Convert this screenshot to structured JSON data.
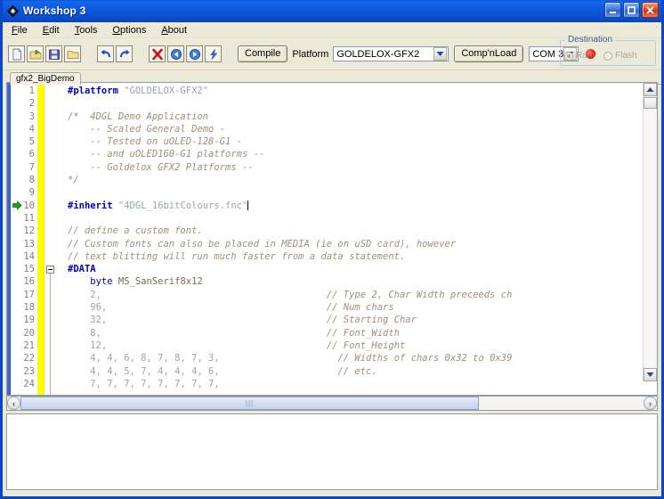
{
  "window": {
    "title": "Workshop 3",
    "icon": "app-diamond-icon",
    "titlebar_color": "#0a54d6",
    "face_color": "#ece9d8",
    "buttons": {
      "minimize": "_",
      "maximize": "□",
      "close": "✕"
    }
  },
  "menu": {
    "items": [
      {
        "label": "File",
        "accel": "F"
      },
      {
        "label": "Edit",
        "accel": "E"
      },
      {
        "label": "Tools",
        "accel": "T"
      },
      {
        "label": "Options",
        "accel": "O"
      },
      {
        "label": "About",
        "accel": "A"
      }
    ]
  },
  "toolbar": {
    "icons": [
      {
        "name": "new-file-icon",
        "tip": "New"
      },
      {
        "name": "open-folder-icon",
        "tip": "Open"
      },
      {
        "name": "save-disk-icon",
        "tip": "Save"
      },
      {
        "name": "folder-icon",
        "tip": "Save As"
      },
      {
        "name": "undo-icon",
        "tip": "Undo"
      },
      {
        "name": "redo-icon",
        "tip": "Redo"
      },
      {
        "name": "close-x-icon",
        "tip": "Close"
      },
      {
        "name": "back-arrow-icon",
        "tip": "Back"
      },
      {
        "name": "forward-arrow-icon",
        "tip": "Forward"
      },
      {
        "name": "lightning-icon",
        "tip": "Run"
      }
    ],
    "compile_label": "Compile",
    "platform_label": "Platform",
    "platform_value": "GOLDELOX-GFX2",
    "compnload_label": "Comp'nLoad",
    "com_value": "COM 3",
    "led": {
      "name": "status-led",
      "color": "#e00b0b"
    },
    "destination": {
      "legend": "Destination",
      "options": [
        {
          "label": "Ram",
          "selected": true
        },
        {
          "label": "Flash",
          "selected": false
        }
      ]
    }
  },
  "tabs": {
    "active": "gfx2_BigDemo",
    "items": [
      "gfx2_BigDemo"
    ]
  },
  "editor": {
    "colors": {
      "preprocessor": "#0000c0",
      "string": "#9aa89a",
      "comment": "#a08f7a",
      "keyword": "#0000c0",
      "identifier": "#7a6a55",
      "gutter_marker": "#ffff00",
      "line_number": "#808080"
    },
    "caret_line": 10,
    "marker_line": 10,
    "fold_line": 15,
    "lines": [
      {
        "n": "1",
        "tokens": [
          {
            "t": "#platform ",
            "c": "pre"
          },
          {
            "t": "\"GOLDELOX-GFX2\"",
            "c": "str"
          }
        ]
      },
      {
        "n": "2",
        "tokens": []
      },
      {
        "n": "3",
        "tokens": [
          {
            "t": "/*  4DGL Demo Application",
            "c": "com"
          }
        ]
      },
      {
        "n": "4",
        "tokens": [
          {
            "t": "    -- Scaled General Demo -",
            "c": "com"
          }
        ]
      },
      {
        "n": "5",
        "tokens": [
          {
            "t": "    -- Tested on uOLED-128-G1 -",
            "c": "com"
          }
        ]
      },
      {
        "n": "6",
        "tokens": [
          {
            "t": "    -- and uOLED160-G1 platforms --",
            "c": "com"
          }
        ]
      },
      {
        "n": "7",
        "tokens": [
          {
            "t": "    -- Goldelox GFX2 Platforms --",
            "c": "com"
          }
        ]
      },
      {
        "n": "8",
        "tokens": [
          {
            "t": "*/",
            "c": "com"
          }
        ]
      },
      {
        "n": "9",
        "tokens": []
      },
      {
        "n": "10",
        "tokens": [
          {
            "t": "#inherit ",
            "c": "pre"
          },
          {
            "t": "\"4DGL_16bitColours.fnc\"",
            "c": "str"
          }
        ],
        "caret": true
      },
      {
        "n": "11",
        "tokens": []
      },
      {
        "n": "12",
        "tokens": [
          {
            "t": "// define a custom font.",
            "c": "com"
          }
        ]
      },
      {
        "n": "13",
        "tokens": [
          {
            "t": "// Custom fonts can also be placed in MEDIA (ie on uSD card), however",
            "c": "com"
          }
        ]
      },
      {
        "n": "14",
        "tokens": [
          {
            "t": "// text blitting will run much faster from a data statement.",
            "c": "com"
          }
        ]
      },
      {
        "n": "15",
        "tokens": [
          {
            "t": "#DATA",
            "c": "pre"
          }
        ]
      },
      {
        "n": "16",
        "tokens": [
          {
            "t": "    byte ",
            "c": "kw"
          },
          {
            "t": "MS_SanSerif8x12",
            "c": "id"
          }
        ]
      },
      {
        "n": "17",
        "tokens": [
          {
            "t": "    2,",
            "c": "num"
          },
          {
            "t": "                                        // Type 2, Char Width preceeds ch",
            "c": "com"
          }
        ]
      },
      {
        "n": "18",
        "tokens": [
          {
            "t": "    96,",
            "c": "num"
          },
          {
            "t": "                                       // Num chars",
            "c": "com"
          }
        ]
      },
      {
        "n": "19",
        "tokens": [
          {
            "t": "    32,",
            "c": "num"
          },
          {
            "t": "                                       // Starting Char",
            "c": "com"
          }
        ]
      },
      {
        "n": "20",
        "tokens": [
          {
            "t": "    8,",
            "c": "num"
          },
          {
            "t": "                                        // Font_Width",
            "c": "com"
          }
        ]
      },
      {
        "n": "21",
        "tokens": [
          {
            "t": "    12,",
            "c": "num"
          },
          {
            "t": "                                       // Font_Height",
            "c": "com"
          }
        ]
      },
      {
        "n": "22",
        "tokens": [
          {
            "t": "    4, 4, 6, 8, 7, 8, 7, 3,",
            "c": "num"
          },
          {
            "t": "                     // Widths of chars 0x32 to 0x39",
            "c": "com"
          }
        ]
      },
      {
        "n": "23",
        "tokens": [
          {
            "t": "    4, 4, 5, 7, 4, 4, 4, 6,",
            "c": "num"
          },
          {
            "t": "                     // etc.",
            "c": "com"
          }
        ]
      },
      {
        "n": "24",
        "tokens": [
          {
            "t": "    7, 7, 7, 7, 7, 7, 7, 7,",
            "c": "num"
          }
        ]
      }
    ],
    "vscroll": {
      "up": "▴",
      "down": "▾"
    },
    "hscroll": {
      "left": "‹",
      "right": "›",
      "grip": "|||"
    }
  },
  "output": {
    "text": ""
  }
}
